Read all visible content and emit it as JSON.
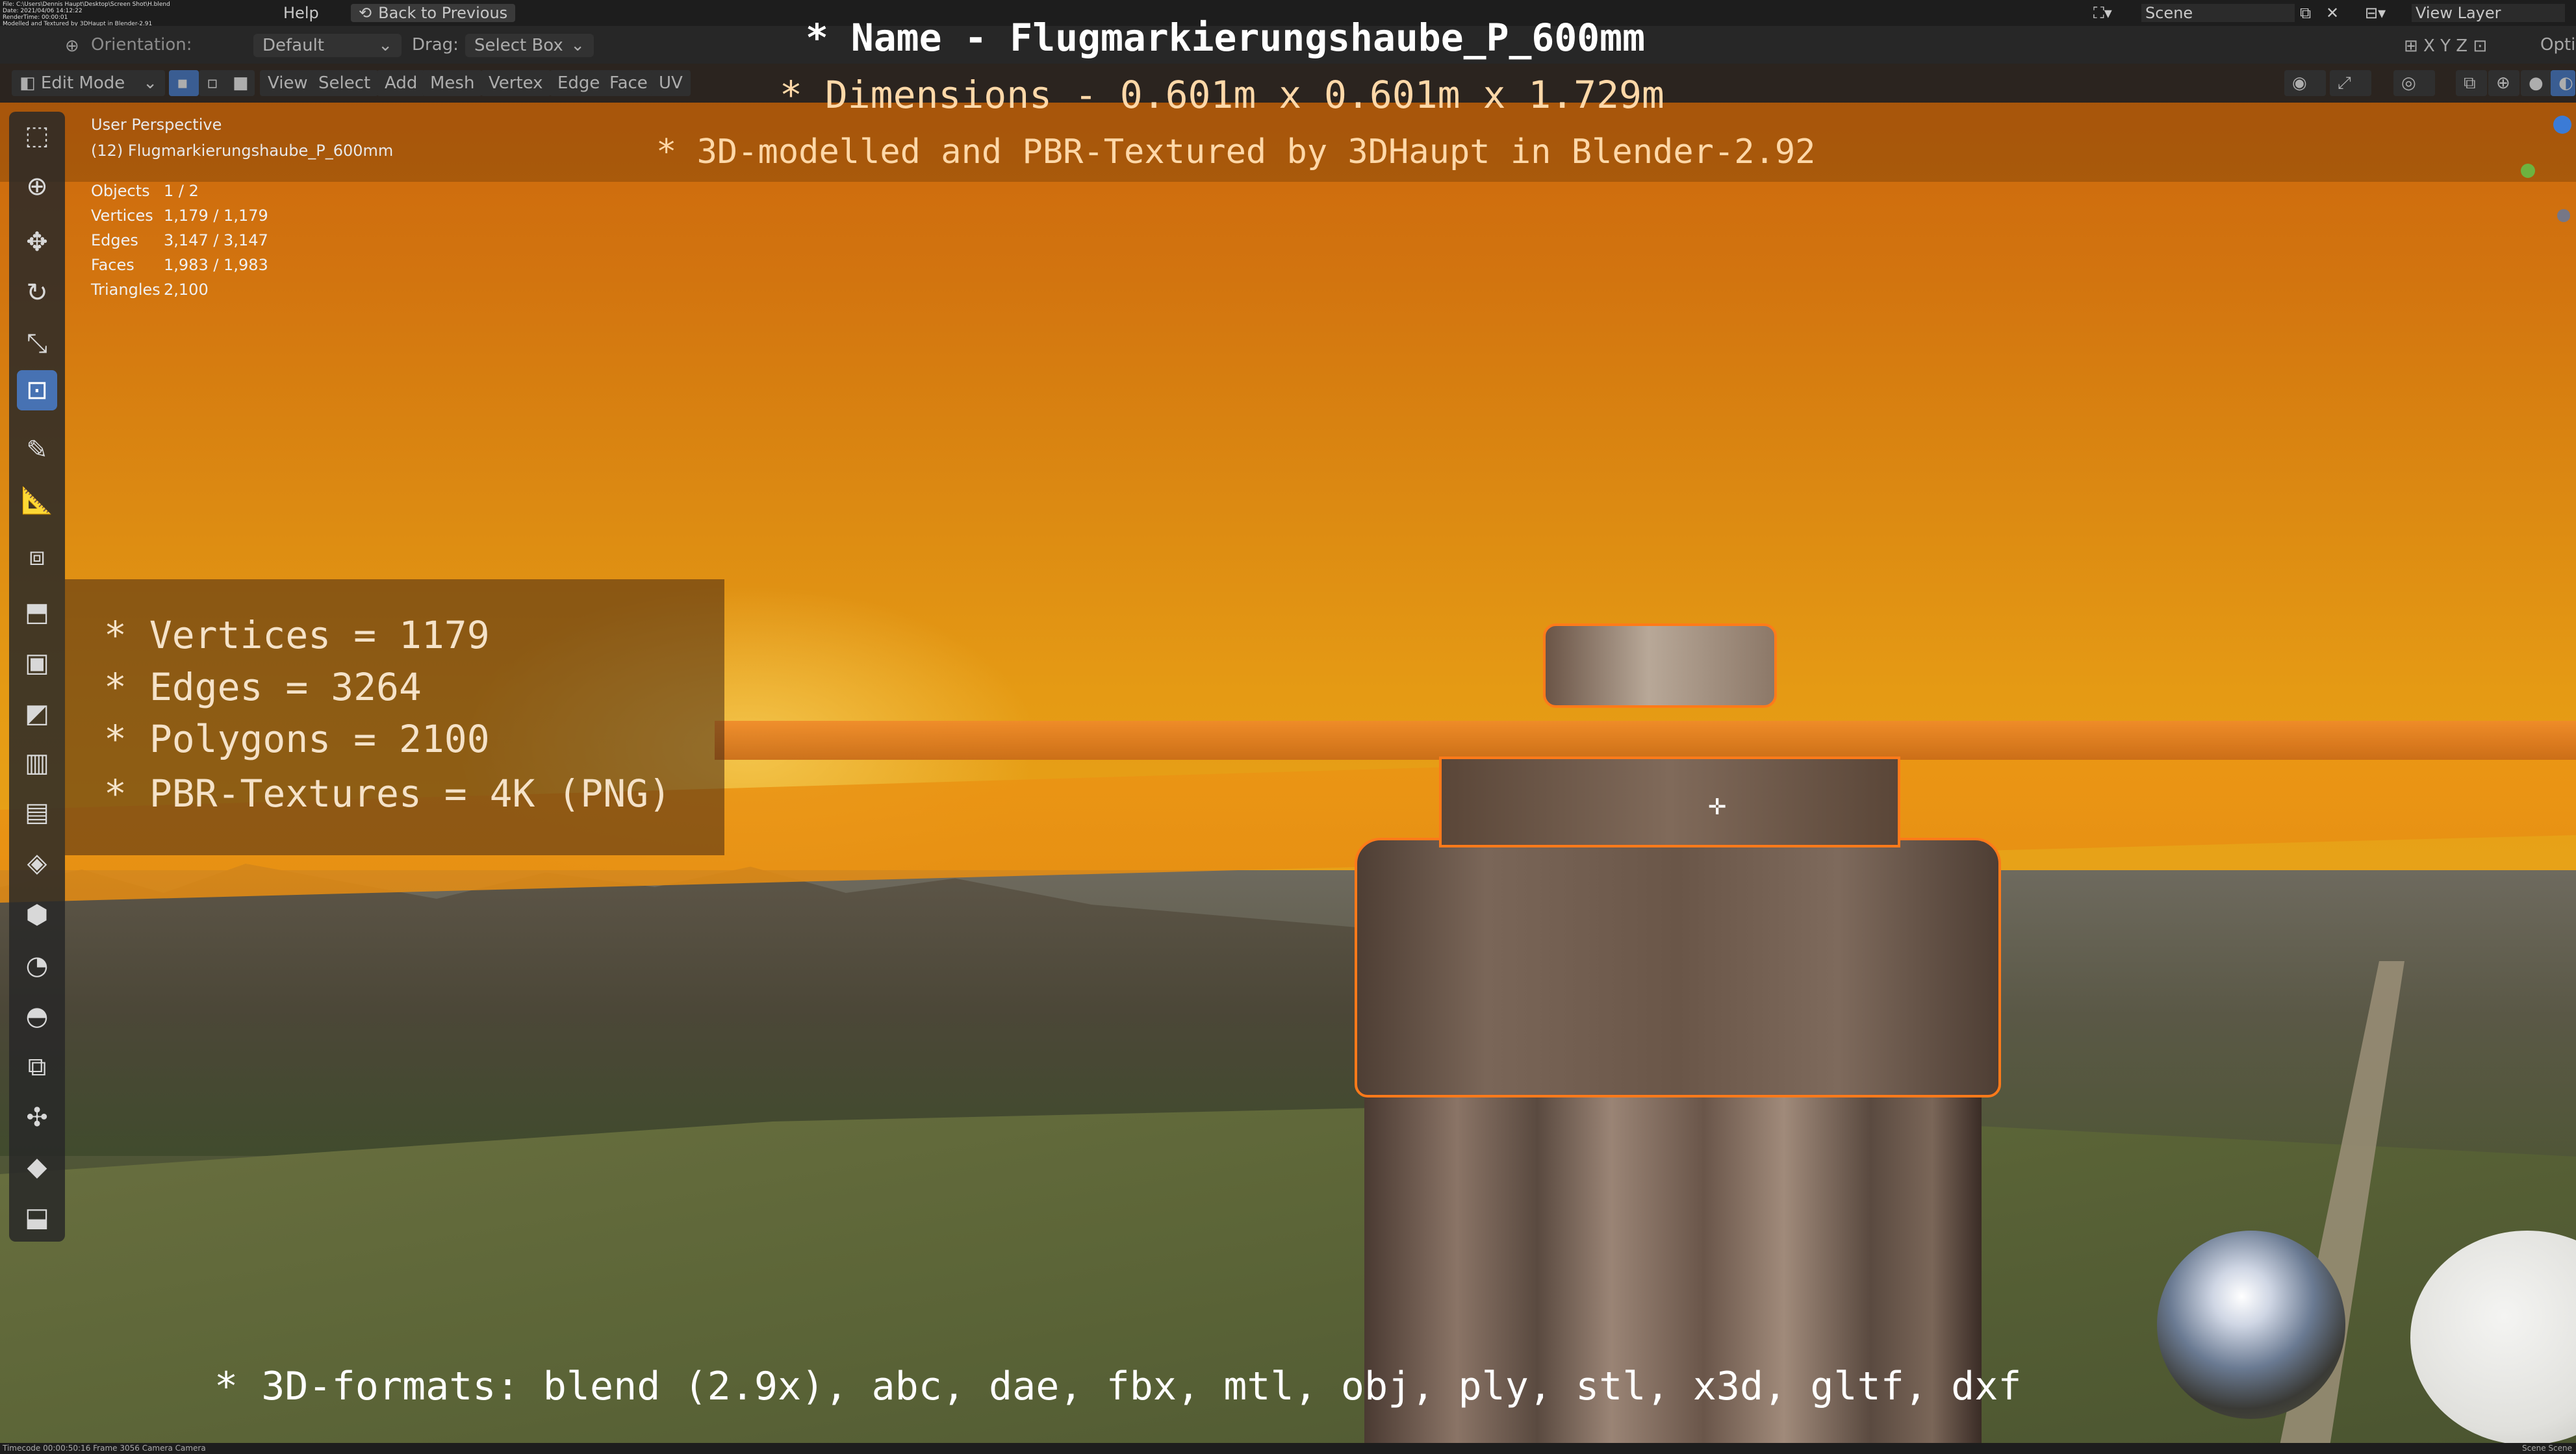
{
  "window": {
    "menu_help": "Help",
    "back_to_previous": "Back to Previous",
    "scene_label": "Scene",
    "view_layer_label": "View Layer",
    "debug_lines": [
      "File: C:\\Users\\Dennis Haupt\\Desktop\\Screen Shot\\H.blend",
      "Date: 2021/04/06 14:12:22",
      "RenderTime: 00:00:01",
      "Modelled and Textured by 3DHaupt in Blender-2.91"
    ]
  },
  "header": {
    "orientation_label": "Orientation:",
    "orientation_value": "Default",
    "drag_label": "Drag:",
    "drag_value": "Select Box",
    "options_label": "Opti"
  },
  "toolbar": {
    "mode": "Edit Mode",
    "menus": [
      "View",
      "Select",
      "Add",
      "Mesh",
      "Vertex",
      "Edge",
      "Face",
      "UV"
    ]
  },
  "viewport": {
    "perspective": "User Perspective",
    "object_name": "(12) Flugmarkierungshaube_P_600mm",
    "stats": [
      {
        "label": "Objects",
        "value": "1 / 2"
      },
      {
        "label": "Vertices",
        "value": "1,179 / 1,179"
      },
      {
        "label": "Edges",
        "value": "3,147 / 3,147"
      },
      {
        "label": "Faces",
        "value": "1,983 / 1,983"
      },
      {
        "label": "Triangles",
        "value": "2,100"
      }
    ]
  },
  "overlay": {
    "name_line": "* Name - Flugmarkierungshaube_P_600mm",
    "dimensions_line": "* Dimensions -  0.601m x 0.601m x 1.729m",
    "credit_line": "* 3D-modelled and PBR-Textured by 3DHaupt in Blender-2.92",
    "stat_lines": [
      "* Vertices = 1179",
      "* Edges = 3264",
      "* Polygons = 2100",
      "* PBR-Textures = 4K (PNG)"
    ],
    "formats_line": "* 3D-formats: blend (2.9x), abc, dae, fbx, mtl, obj, ply, stl, x3d, gltf, dxf"
  },
  "status_bar": {
    "left": "Timecode 00:00:50:16   Frame 3056   Camera Camera",
    "right": "Scene Scene"
  },
  "colors": {
    "accent": "#4772b3",
    "title_text": "#ffffff",
    "overlay_text": "#ffd8a8",
    "selection": "#ff7a1a"
  }
}
